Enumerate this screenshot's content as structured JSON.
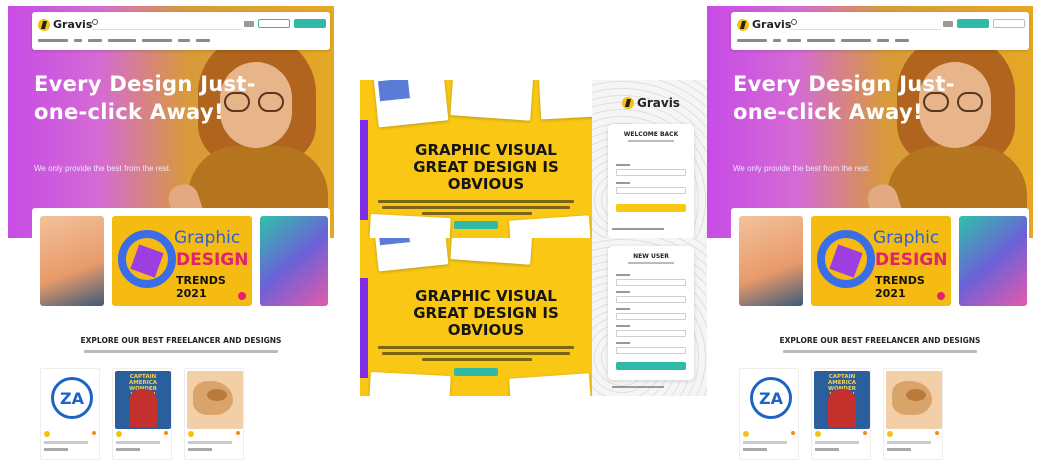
{
  "brand": {
    "name": "Gravis",
    "accent": "#fac814",
    "teal": "#2fb9a6",
    "purple": "#c84be6",
    "pink": "#e0246b",
    "blue": "#2a62d6"
  },
  "landing": {
    "hero_title": "Every Design Just-one-click Away!",
    "hero_subtitle": "We only provide the best from the rest.",
    "graphic_card": {
      "line1": "Graphic",
      "line2": "DESIGN",
      "line3": "TRENDS 2021"
    },
    "explore_heading": "EXPLORE OUR BEST FREELANCER AND DESIGNS",
    "cards": [
      {
        "image_text": "ZA"
      },
      {
        "image_text": "CAPTAIN AMERICA WONDER WOMAN"
      },
      {
        "image_text": ""
      }
    ]
  },
  "login": {
    "headline": "GRAPHIC VISUAL GREAT DESIGN IS OBVIOUS",
    "logo_text": "Gravis",
    "welcome_title": "WELCOME BACK",
    "new_account_title": "NEW USER"
  }
}
